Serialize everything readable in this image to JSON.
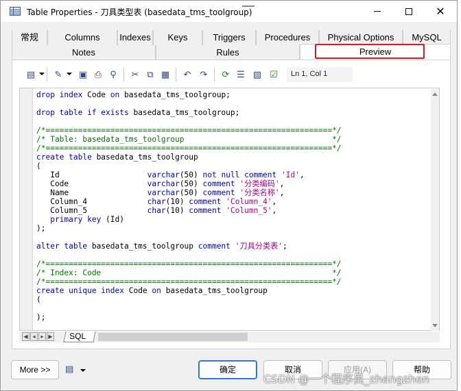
{
  "window": {
    "title": "Table Properties - 刀具类型表 (basedata_tms_toolgroup)",
    "minimize": "—",
    "maximize": "☐",
    "close": "✕"
  },
  "tabs_row1": [
    "常规",
    "Columns",
    "Indexes",
    "Keys",
    "Triggers",
    "Procedures",
    "Physical Options",
    "MySQL"
  ],
  "tabs_row2": [
    "Notes",
    "Rules",
    "Preview"
  ],
  "active_tab": "Preview",
  "highlight_color": "#e0191c",
  "toolbar": {
    "icons": [
      "script-dropdown-icon",
      "edit-dropdown-icon",
      "save-icon",
      "print-icon",
      "find-icon",
      "cut-icon",
      "copy-icon",
      "paste-icon",
      "undo-icon",
      "redo-icon",
      "refresh-icon",
      "properties-icon",
      "edit-properties-icon",
      "check-icon"
    ],
    "cursor_position": "Ln 1, Col 1"
  },
  "sql_lines": [
    [
      [
        "kw",
        "drop index "
      ],
      [
        "",
        "Code "
      ],
      [
        "kw",
        "on "
      ],
      [
        "",
        "basedata_tms_toolgroup;"
      ]
    ],
    [],
    [
      [
        "kw",
        "drop table if exists "
      ],
      [
        "",
        "basedata_tms_toolgroup;"
      ]
    ],
    [],
    [
      [
        "cm",
        "/*==============================================================*/"
      ]
    ],
    [
      [
        "cm",
        "/* Table: basedata_tms_toolgroup                                */"
      ]
    ],
    [
      [
        "cm",
        "/*==============================================================*/"
      ]
    ],
    [
      [
        "kw",
        "create table "
      ],
      [
        "",
        "basedata_tms_toolgroup"
      ]
    ],
    [
      [
        "",
        "("
      ]
    ],
    [
      [
        "",
        "   Id                   "
      ],
      [
        "kw",
        "varchar"
      ],
      [
        "",
        "(50) "
      ],
      [
        "kw",
        "not null comment "
      ],
      [
        "str",
        "'Id'"
      ],
      [
        ",",
        ","
      ]
    ],
    [
      [
        "",
        "   Code                 "
      ],
      [
        "kw",
        "varchar"
      ],
      [
        "",
        "(50) "
      ],
      [
        "kw",
        "comment "
      ],
      [
        "str",
        "'分类编码'"
      ],
      [
        "",
        ","
      ]
    ],
    [
      [
        "",
        "   Name                 "
      ],
      [
        "kw",
        "varchar"
      ],
      [
        "",
        "(50) "
      ],
      [
        "kw",
        "comment "
      ],
      [
        "str",
        "'分类名称'"
      ],
      [
        "",
        ","
      ]
    ],
    [
      [
        "",
        "   Column_4             "
      ],
      [
        "kw",
        "char"
      ],
      [
        "",
        "(10) "
      ],
      [
        "kw",
        "comment "
      ],
      [
        "str",
        "'Column_4'"
      ],
      [
        "",
        ","
      ]
    ],
    [
      [
        "",
        "   Column_5             "
      ],
      [
        "kw",
        "char"
      ],
      [
        "",
        "(10) "
      ],
      [
        "kw",
        "comment "
      ],
      [
        "str",
        "'Column_5'"
      ],
      [
        "",
        ","
      ]
    ],
    [
      [
        "",
        "   "
      ],
      [
        "kw",
        "primary key "
      ],
      [
        "",
        "(Id)"
      ]
    ],
    [
      [
        "",
        ");"
      ]
    ],
    [],
    [
      [
        "kw",
        "alter table "
      ],
      [
        "",
        "basedata_tms_toolgroup "
      ],
      [
        "kw",
        "comment "
      ],
      [
        "str",
        "'刀具分类表'"
      ],
      [
        "",
        ";"
      ]
    ],
    [],
    [
      [
        "cm",
        "/*==============================================================*/"
      ]
    ],
    [
      [
        "cm",
        "/* Index: Code                                                  */"
      ]
    ],
    [
      [
        "cm",
        "/*==============================================================*/"
      ]
    ],
    [
      [
        "kw",
        "create unique index "
      ],
      [
        "",
        "Code "
      ],
      [
        "kw",
        "on "
      ],
      [
        "",
        "basedata_tms_toolgroup"
      ]
    ],
    [
      [
        "",
        "("
      ]
    ],
    [],
    [
      [
        "",
        ");"
      ]
    ]
  ],
  "sheet_tab": "SQL",
  "buttons": {
    "more": "More >>",
    "ok": "确定",
    "cancel": "取消",
    "apply": "应用(A)",
    "help": "帮助"
  },
  "watermark": "CSDN @一个程序员_zhangzhen"
}
